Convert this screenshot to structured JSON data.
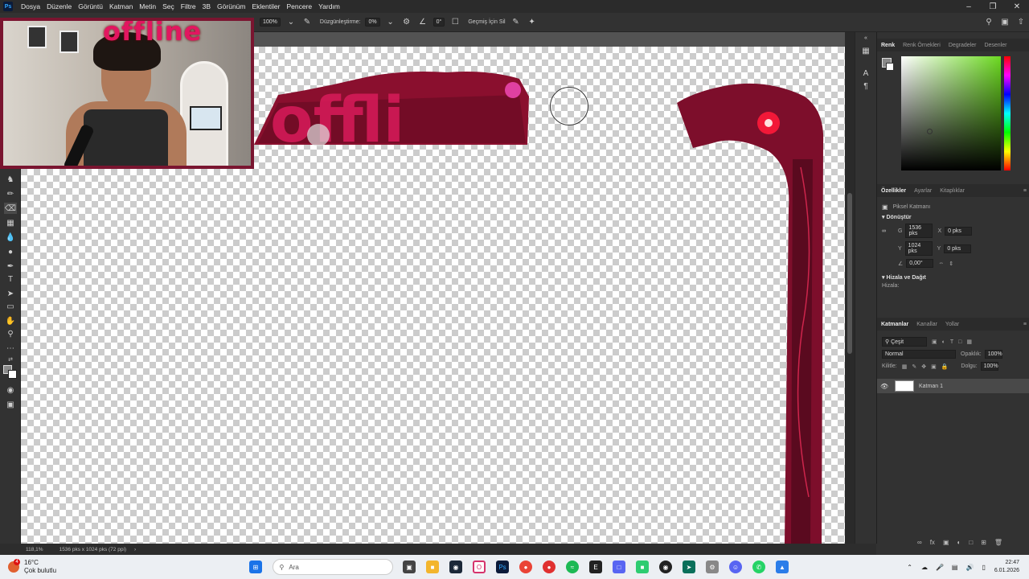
{
  "menubar": {
    "items": [
      "Dosya",
      "Düzenle",
      "Görüntü",
      "Katman",
      "Metin",
      "Seç",
      "Filtre",
      "3B",
      "Görünüm",
      "Eklentiler",
      "Pencere",
      "Yardım"
    ]
  },
  "options": {
    "opacity_value": "100%",
    "smoothing_label": "Düzgünleştirme:",
    "smoothing_value": "0%",
    "angle_value": "0°",
    "history_label": "Geçmiş İçin Sil"
  },
  "webcam": {
    "title": "offline"
  },
  "color_panel": {
    "tabs": [
      "Renk",
      "Renk Örnekleri",
      "Degradeler",
      "Desenler"
    ]
  },
  "properties": {
    "tabs": [
      "Özellikler",
      "Ayarlar",
      "Kitaplıklar"
    ],
    "layer_type": "Piksel Katmanı",
    "transform_title": "Dönüştür",
    "w_label": "G",
    "w_value": "1536 pks",
    "x_label": "X",
    "x_value": "0 pks",
    "h_label": "Y",
    "h_value": "1024 pks",
    "y_label": "Y",
    "y_value": "0 pks",
    "angle_value": "0,00°",
    "align_title": "Hizala ve Dağıt",
    "align_label": "Hizala:"
  },
  "layers": {
    "tabs": [
      "Katmanlar",
      "Kanallar",
      "Yollar"
    ],
    "filter_label": "Çeşit",
    "blend_mode": "Normal",
    "opacity_label": "Opaklık:",
    "opacity_value": "100%",
    "lock_label": "Kilitle:",
    "fill_label": "Dolgu:",
    "fill_value": "100%",
    "items": [
      {
        "name": "Katman 1"
      }
    ]
  },
  "status": {
    "zoom": "118,1%",
    "doc_info": "1536 pks x 1024 pks (72 ppi)"
  },
  "taskbar": {
    "temperature": "16°C",
    "condition": "Çok bulutlu",
    "weather_badge": "4",
    "search_placeholder": "Ara",
    "time": "22:47",
    "date": "6.01.2026"
  },
  "colors": {
    "accent_red": "#c8103e",
    "panel_bg": "#323232",
    "picker_hue": "#6cd921"
  }
}
